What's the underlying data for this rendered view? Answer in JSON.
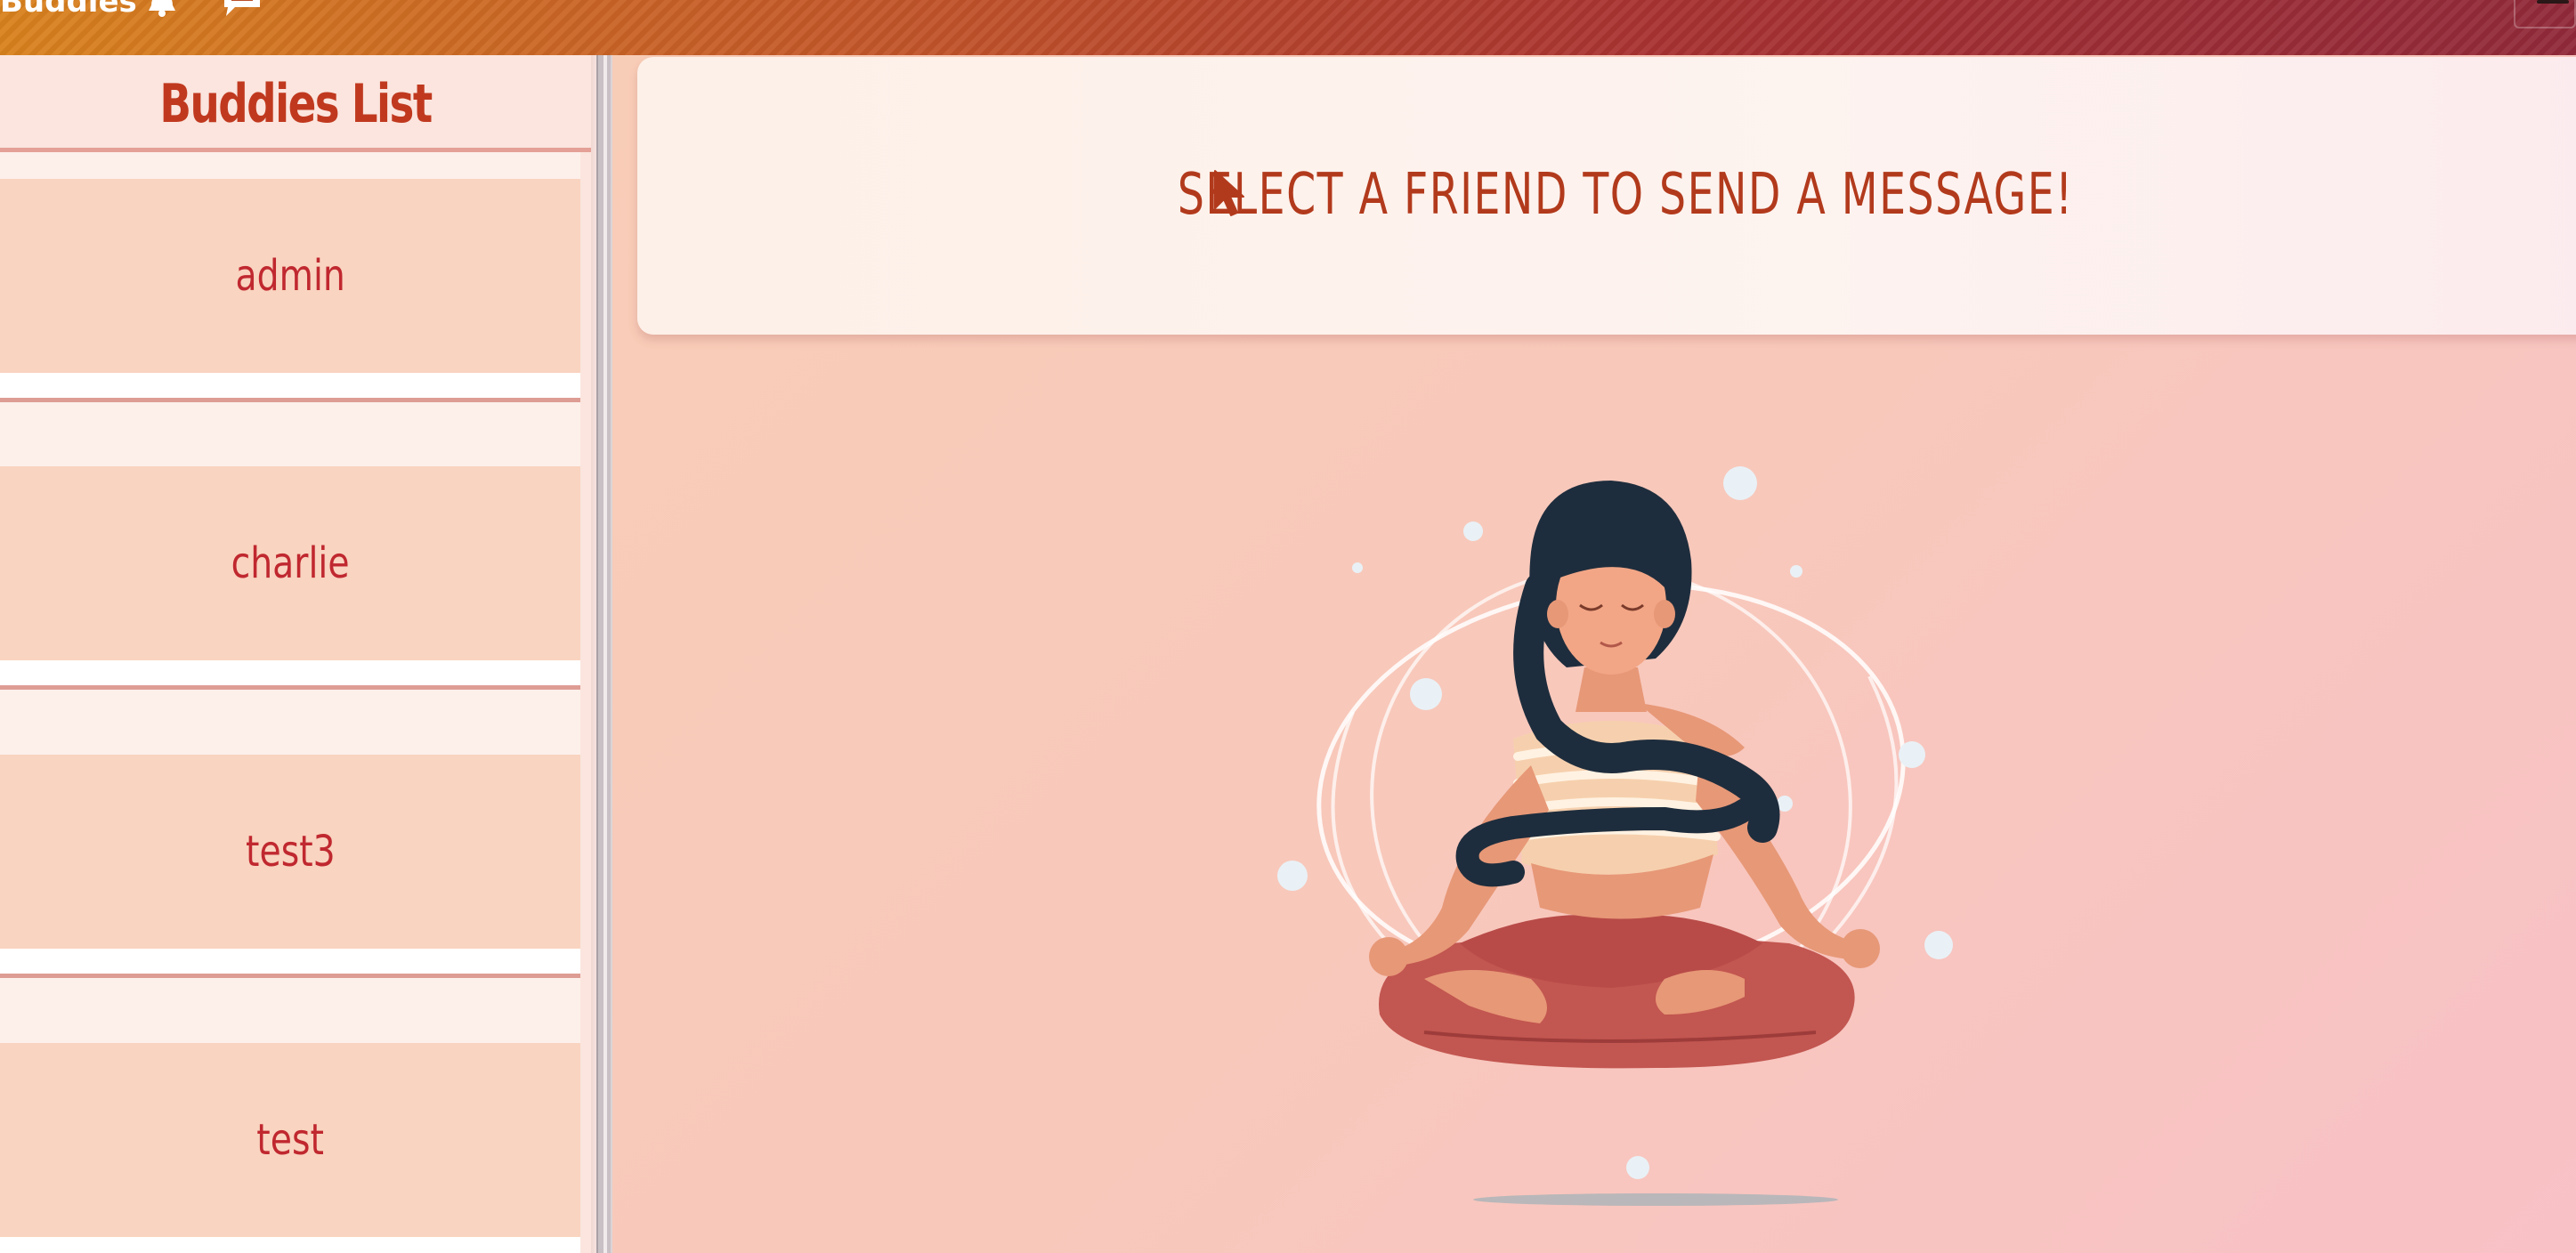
{
  "navbar": {
    "brand": "Buddies",
    "icons": [
      "bell-icon",
      "chat-icon",
      "menu-icon"
    ],
    "colors": {
      "gradient_start": "#d9821e",
      "gradient_end": "#922a3a"
    }
  },
  "sidebar": {
    "title": "Buddies List",
    "items": [
      {
        "label": "admin"
      },
      {
        "label": "charlie"
      },
      {
        "label": "test3"
      },
      {
        "label": "test"
      }
    ]
  },
  "main": {
    "prompt": "SELECT A FRIEND TO SEND A MESSAGE!",
    "illustration": "meditating-woman-illustration"
  },
  "colors": {
    "accent": "#c0391f",
    "buddy_text": "#c0282f",
    "buddy_bg": "#f9d4c0"
  }
}
